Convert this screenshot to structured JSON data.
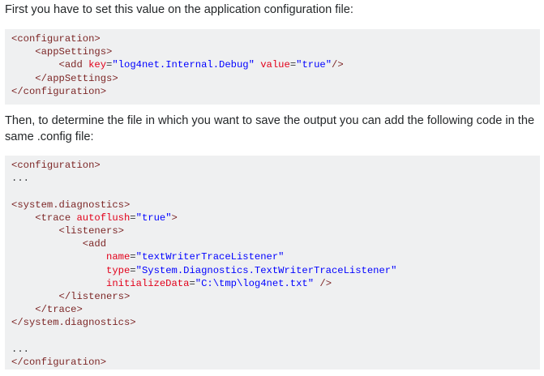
{
  "intro_paragraph": "First you have to set this value on the application configuration file:",
  "second_paragraph": "Then, to determine the file in which you want to save the output you can add the following code in the same .config file:",
  "code_colors": {
    "tag": "#7d2727",
    "attribute": "#e2001a",
    "string": "#0000ff",
    "text": "#303336",
    "background": "#eff0f1"
  },
  "code_block_1": [
    [
      {
        "t": "tag",
        "v": "<configuration>"
      }
    ],
    [
      {
        "t": "txt",
        "v": "    "
      },
      {
        "t": "tag",
        "v": "<appSettings>"
      }
    ],
    [
      {
        "t": "txt",
        "v": "        "
      },
      {
        "t": "tag",
        "v": "<add "
      },
      {
        "t": "attr",
        "v": "key"
      },
      {
        "t": "txt",
        "v": "="
      },
      {
        "t": "str",
        "v": "\"log4net.Internal.Debug\""
      },
      {
        "t": "txt",
        "v": " "
      },
      {
        "t": "attr",
        "v": "value"
      },
      {
        "t": "txt",
        "v": "="
      },
      {
        "t": "str",
        "v": "\"true\""
      },
      {
        "t": "tag",
        "v": "/>"
      }
    ],
    [
      {
        "t": "txt",
        "v": "    "
      },
      {
        "t": "tag",
        "v": "</appSettings>"
      }
    ],
    [
      {
        "t": "tag",
        "v": "</configuration>"
      }
    ]
  ],
  "code_block_2": [
    [
      {
        "t": "tag",
        "v": "<configuration>"
      }
    ],
    [
      {
        "t": "txt",
        "v": "..."
      }
    ],
    [
      {
        "t": "txt",
        "v": ""
      }
    ],
    [
      {
        "t": "tag",
        "v": "<system.diagnostics>"
      }
    ],
    [
      {
        "t": "txt",
        "v": "    "
      },
      {
        "t": "tag",
        "v": "<trace "
      },
      {
        "t": "attr",
        "v": "autoflush"
      },
      {
        "t": "txt",
        "v": "="
      },
      {
        "t": "str",
        "v": "\"true\""
      },
      {
        "t": "tag",
        "v": ">"
      }
    ],
    [
      {
        "t": "txt",
        "v": "        "
      },
      {
        "t": "tag",
        "v": "<listeners>"
      }
    ],
    [
      {
        "t": "txt",
        "v": "            "
      },
      {
        "t": "tag",
        "v": "<add"
      }
    ],
    [
      {
        "t": "txt",
        "v": "                "
      },
      {
        "t": "attr",
        "v": "name"
      },
      {
        "t": "txt",
        "v": "="
      },
      {
        "t": "str",
        "v": "\"textWriterTraceListener\""
      }
    ],
    [
      {
        "t": "txt",
        "v": "                "
      },
      {
        "t": "attr",
        "v": "type"
      },
      {
        "t": "txt",
        "v": "="
      },
      {
        "t": "str",
        "v": "\"System.Diagnostics.TextWriterTraceListener\""
      }
    ],
    [
      {
        "t": "txt",
        "v": "                "
      },
      {
        "t": "attr",
        "v": "initializeData"
      },
      {
        "t": "txt",
        "v": "="
      },
      {
        "t": "str",
        "v": "\"C:\\tmp\\log4net.txt\""
      },
      {
        "t": "txt",
        "v": " "
      },
      {
        "t": "tag",
        "v": "/>"
      }
    ],
    [
      {
        "t": "txt",
        "v": "        "
      },
      {
        "t": "tag",
        "v": "</listeners>"
      }
    ],
    [
      {
        "t": "txt",
        "v": "    "
      },
      {
        "t": "tag",
        "v": "</trace>"
      }
    ],
    [
      {
        "t": "tag",
        "v": "</system.diagnostics>"
      }
    ],
    [
      {
        "t": "txt",
        "v": ""
      }
    ],
    [
      {
        "t": "txt",
        "v": "..."
      }
    ],
    [
      {
        "t": "tag",
        "v": "</configuration>"
      }
    ]
  ]
}
